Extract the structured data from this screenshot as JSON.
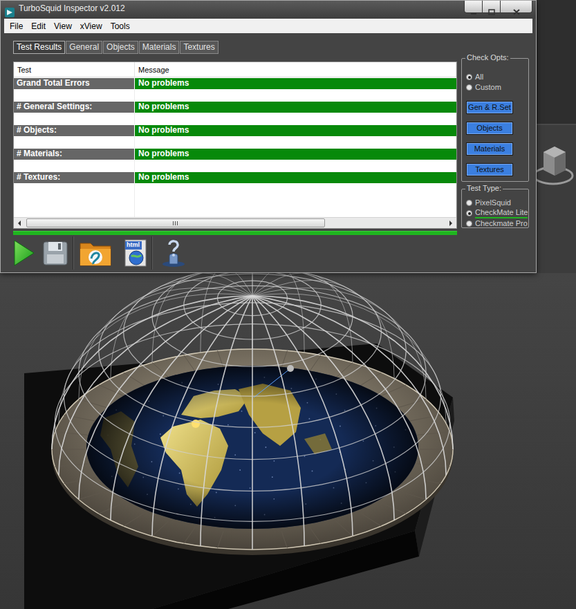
{
  "window": {
    "title": "TurboSquid Inspector v2.012"
  },
  "menu": [
    "File",
    "Edit",
    "View",
    "xView",
    "Tools"
  ],
  "tabs": [
    {
      "label": "Test Results",
      "selected": true
    },
    {
      "label": "General",
      "selected": false
    },
    {
      "label": "Objects",
      "selected": false
    },
    {
      "label": "Materials",
      "selected": false
    },
    {
      "label": "Textures",
      "selected": false
    }
  ],
  "table": {
    "columns": [
      "Test",
      "Message"
    ],
    "rows": [
      [
        "Grand Total Errors",
        "No problems"
      ],
      [
        "# General Settings:",
        "No problems"
      ],
      [
        "# Objects:",
        "No problems"
      ],
      [
        "# Materials:",
        "No problems"
      ],
      [
        "# Textures:",
        "No problems"
      ]
    ]
  },
  "scrollbar": {
    "level": 0.71
  },
  "progress": {
    "level": 1
  },
  "check_opts": {
    "title": "Check Opts:",
    "options": [
      {
        "label": "All",
        "selected": true
      },
      {
        "label": "Custom",
        "selected": false
      }
    ],
    "buttons": [
      "Gen & R.Set",
      "Objects",
      "Materials",
      "Textures"
    ]
  },
  "test_type": {
    "title": "Test Type:",
    "options": [
      {
        "label": "PixelSquid",
        "selected": false
      },
      {
        "label": "CheckMate Lite",
        "selected": true
      },
      {
        "label": "Checkmate Pro",
        "selected": false
      }
    ]
  },
  "toolbar": {
    "html_icon_text": "html"
  }
}
